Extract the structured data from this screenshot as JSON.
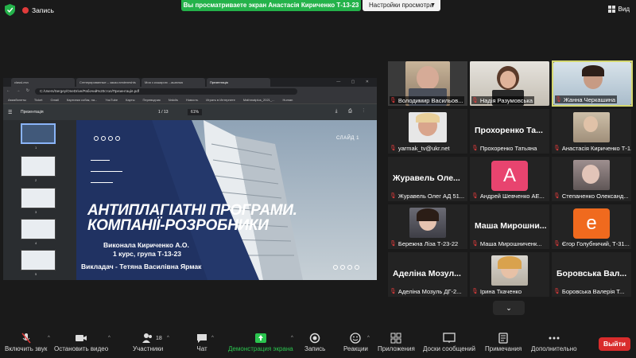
{
  "topbar": {
    "record_label": "Запись",
    "share_banner": "Вы просматриваете экран Анастасія Кириченко Т-13-23",
    "view_options": "Настройки просмотра",
    "view_label": "Вид"
  },
  "browser": {
    "tabs": [
      "classLesn",
      "Сгенерированные – заказ.nesteneshts",
      "Моя з кошарою ...ашюнка",
      "Презентація"
    ],
    "address": "C:/Users/Sergey/OneDrive/Рабочий%20стол/Презентація.pdf",
    "bookmarks": [
      "Авиабилеты",
      "Ticket",
      "Gmail",
      "Картинки собак, на...",
      "YouTube",
      "Карты",
      "Переводчик",
      "Nrdclis",
      "Новость",
      "Играть в Интернете",
      "Mathmatplus_2021_...",
      "Human"
    ]
  },
  "pdf": {
    "title": "Презентація",
    "pages": "1 / 13",
    "zoom": "61%",
    "thumb_numbers": [
      "1",
      "2",
      "3",
      "4",
      "5"
    ]
  },
  "slide": {
    "slide_label": "СЛАЙД 1",
    "title_line1": "АНТИПЛАГІАТНІ ПРОГРАМИ.",
    "title_line2": "КОМПАНІЇ-РОЗРОБНИКИ",
    "author": "Виконала Кириченко А.О.",
    "group": "1 курс, група Т-13-23",
    "teacher": "Викладач - Тетяна Василівна Ярмак"
  },
  "participants": [
    {
      "name": "Володимир Васильов...",
      "type": "video"
    },
    {
      "name": "Надія Разумовська",
      "type": "video"
    },
    {
      "name": "Жанна Черкашина",
      "type": "video"
    },
    {
      "name": "yarmak_tv@ukr.net",
      "type": "photo"
    },
    {
      "name": "Прохоренко Татьяна",
      "big": "Прохоренко Та...",
      "type": "name"
    },
    {
      "name": "Анастасія Кириченко Т-1...",
      "type": "photo"
    },
    {
      "name": "Журавель Олег АД 51...",
      "big": "Журавель Оле...",
      "type": "name"
    },
    {
      "name": "Андрей Шевченко АЕ...",
      "letter": "A",
      "type": "letter"
    },
    {
      "name": "Степаненко Олександ...",
      "type": "photo"
    },
    {
      "name": "Бережна Ліза Т-23-22",
      "type": "photo"
    },
    {
      "name": "Маша Мирошниченк...",
      "big": "Маша Мирошни...",
      "type": "name"
    },
    {
      "name": "Єгор Голубничий, Т-31...",
      "letter": "e",
      "type": "letter"
    },
    {
      "name": "Аделіна Мозуль ДГ-2...",
      "big": "Аделіна Мозул...",
      "type": "name"
    },
    {
      "name": "Ірина Ткаченко",
      "type": "photo"
    },
    {
      "name": "Боровська Валерія Т...",
      "big": "Боровська Вал...",
      "type": "name"
    }
  ],
  "colors": {
    "share_green": "#24b24a",
    "leave_red": "#d92c2c",
    "letter_pink": "#e8446f",
    "letter_orange": "#f06a1e",
    "speaker_border": "#d5d870"
  },
  "toolbar": {
    "mute": "Включить звук",
    "video": "Остановить видео",
    "participants": "Участники",
    "participants_count": "18",
    "chat": "Чат",
    "share": "Демонстрация экрана",
    "record": "Запись",
    "reactions": "Реакции",
    "apps": "Приложения",
    "whiteboard": "Доски сообщений",
    "notes": "Примечания",
    "more": "Дополнительно",
    "leave": "Выйти"
  }
}
